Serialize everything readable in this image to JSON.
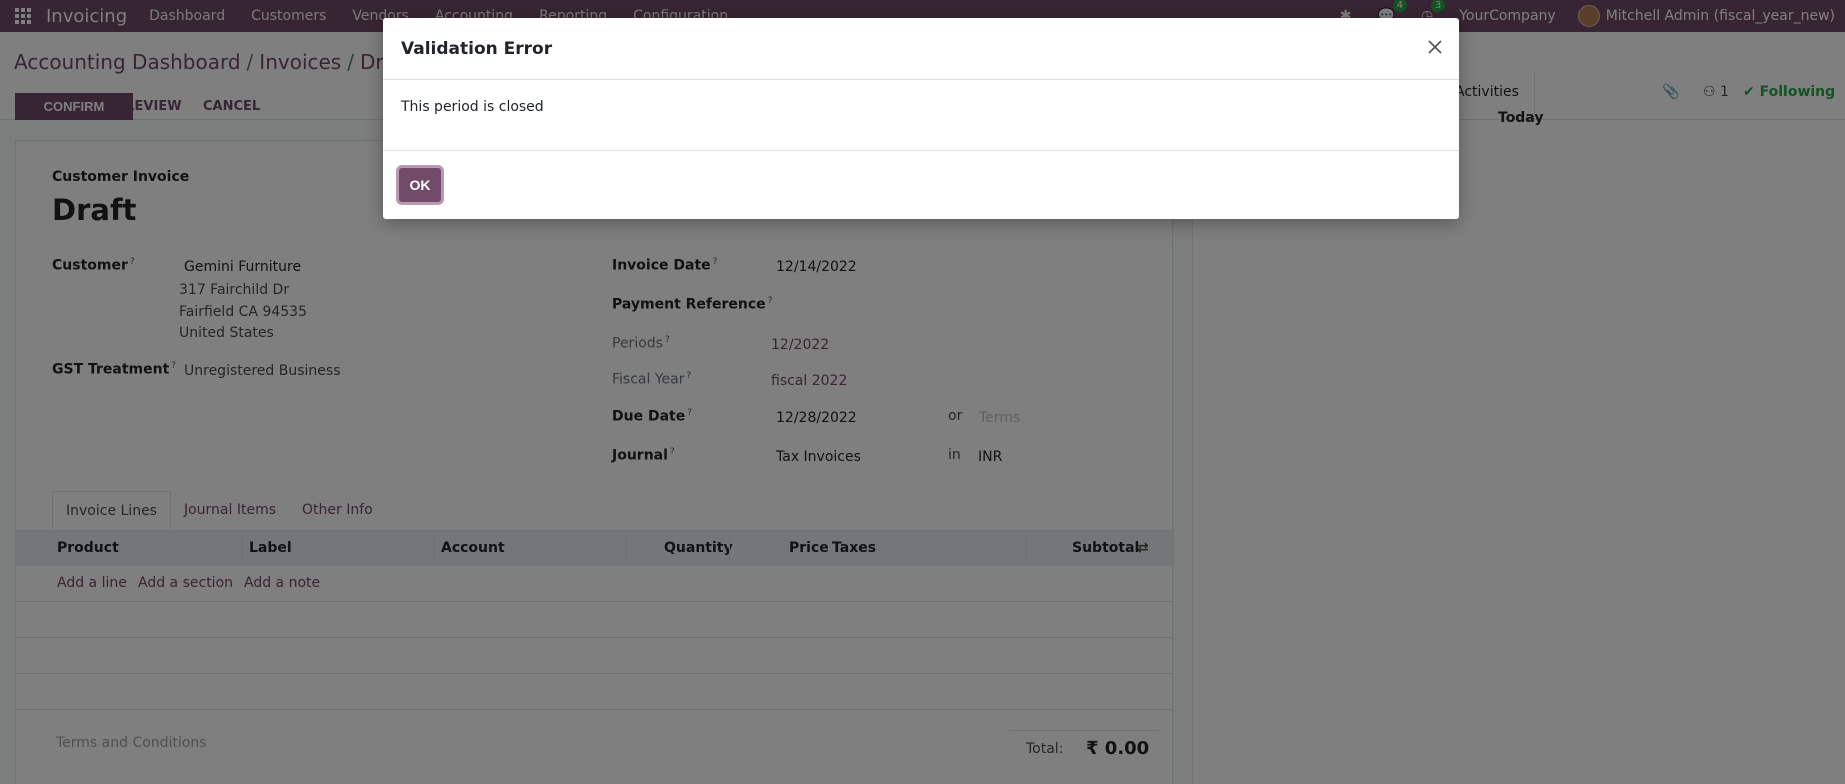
{
  "navbar": {
    "brand": "Invoicing",
    "menus": [
      "Dashboard",
      "Customers",
      "Vendors",
      "Accounting",
      "Reporting",
      "Configuration"
    ],
    "messages_badge": "4",
    "activities_badge": "3",
    "company": "YourCompany",
    "user": "Mitchell Admin (fiscal_year_new)"
  },
  "breadcrumb": {
    "root": "Accounting Dashboard",
    "middle": "Invoices",
    "current": "Draft"
  },
  "actions": {
    "confirm": "CONFIRM",
    "preview": "PREVIEW",
    "cancel": "CANCEL"
  },
  "chatter": {
    "activities": "Activities",
    "followers_count": "1",
    "following": "Following",
    "today": "Today"
  },
  "form": {
    "type_label": "Customer Invoice",
    "status": "Draft",
    "customer_label": "Customer",
    "customer_name": "Gemini Furniture",
    "address_line1": "317 Fairchild Dr",
    "address_line2": "Fairfield CA 94535",
    "address_line3": "United States",
    "gst_label": "GST Treatment",
    "gst_value": "Unregistered Business",
    "invoice_date_label": "Invoice Date",
    "invoice_date": "12/14/2022",
    "payment_ref_label": "Payment Reference",
    "periods_label": "Periods",
    "periods_value": "12/2022",
    "fiscal_year_label": "Fiscal Year",
    "fiscal_year_value": "fiscal 2022",
    "due_date_label": "Due Date",
    "due_date": "12/28/2022",
    "or_text": "or",
    "terms_placeholder": "Terms",
    "journal_label": "Journal",
    "journal_value": "Tax Invoices",
    "in_text": "in",
    "currency": "INR",
    "help_mark": "?"
  },
  "tabs": [
    "Invoice Lines",
    "Journal Items",
    "Other Info"
  ],
  "table": {
    "headers": {
      "product": "Product",
      "label": "Label",
      "account": "Account",
      "quantity": "Quantity",
      "price": "Price",
      "taxes": "Taxes",
      "subtotal": "Subtotal"
    },
    "add_line": "Add a line",
    "add_section": "Add a section",
    "add_note": "Add a note"
  },
  "footer": {
    "terms": "Terms and Conditions",
    "total_label": "Total:",
    "total_value": "₹ 0.00"
  },
  "modal": {
    "title": "Validation Error",
    "message": "This period is closed",
    "ok": "OK"
  }
}
